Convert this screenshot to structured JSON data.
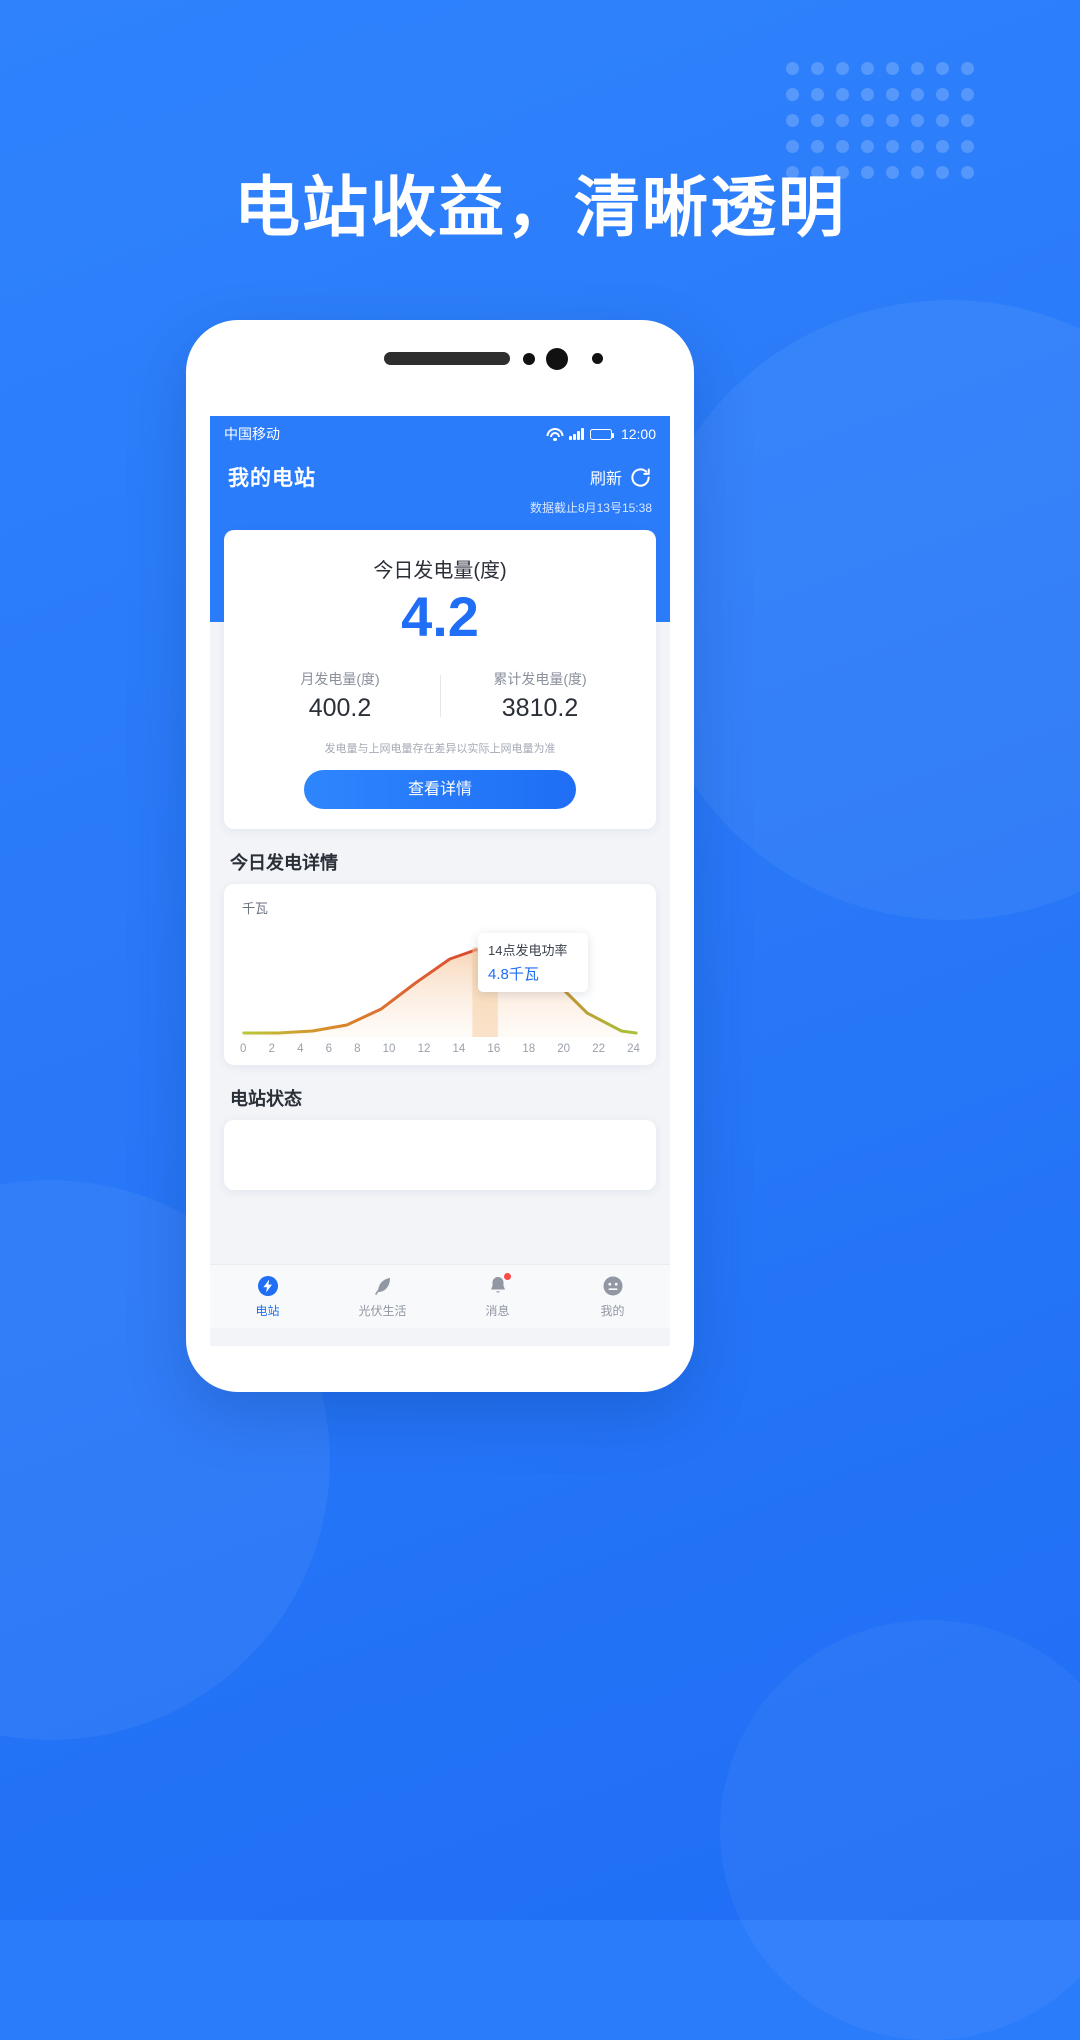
{
  "promo": {
    "headline": "电站收益，清晰透明"
  },
  "phone": {
    "statusbar": {
      "carrier": "中国移动",
      "wifi_icon": "wifi-icon",
      "signal_icon": "signal-bars-icon",
      "battery_icon": "battery-full-icon",
      "time": "12:00"
    },
    "header": {
      "title": "我的电站",
      "refresh_label": "刷新",
      "refresh_icon": "refresh-icon",
      "data_timestamp": "数据截止8月13号15:38"
    },
    "main_card": {
      "today_label": "今日发电量(度)",
      "today_value": "4.2",
      "stats": [
        {
          "label": "月发电量(度)",
          "value": "400.2"
        },
        {
          "label": "累计发电量(度)",
          "value": "3810.2"
        }
      ],
      "disclaimer": "发电量与上网电量存在差异以实际上网电量为准",
      "detail_button": "查看详情"
    },
    "chart_section": {
      "title": "今日发电详情",
      "unit": "千瓦",
      "tooltip": {
        "title": "14点发电功率",
        "value": "4.8千瓦"
      }
    },
    "status_section": {
      "title": "电站状态"
    },
    "tabbar": [
      {
        "label": "电站",
        "icon": "power-station-icon",
        "active": true,
        "badge": false
      },
      {
        "label": "光伏生活",
        "icon": "leaf-icon",
        "active": false,
        "badge": false
      },
      {
        "label": "消息",
        "icon": "bell-icon",
        "active": false,
        "badge": true
      },
      {
        "label": "我的",
        "icon": "user-icon",
        "active": false,
        "badge": false
      }
    ]
  },
  "colors": {
    "brand_blue": "#2b7cfb",
    "accent_blue": "#1f6ef5",
    "chart_line_hot": "#e0523a",
    "chart_line_cool": "#a8c23a",
    "marker": "#f2701f",
    "badge_red": "#fa4b4b"
  },
  "chart_data": {
    "type": "area",
    "title": "今日发电详情",
    "xlabel": "",
    "ylabel": "千瓦",
    "unit": "千瓦",
    "x": [
      0,
      2,
      4,
      6,
      8,
      10,
      12,
      14,
      16,
      18,
      20,
      22,
      24
    ],
    "values": [
      0,
      0,
      0,
      0.2,
      1.4,
      3.4,
      4.6,
      4.8,
      4.4,
      2.6,
      0.6,
      0,
      0
    ],
    "tick_labels": [
      "0",
      "2",
      "4",
      "6",
      "8",
      "10",
      "12",
      "14",
      "16",
      "18",
      "20",
      "22",
      "24"
    ],
    "ylim": [
      0,
      5.2
    ],
    "grid": false,
    "legend": "none",
    "highlight": {
      "x": 14,
      "y": 4.8,
      "label": "14点发电功率",
      "value_label": "4.8千瓦"
    }
  }
}
